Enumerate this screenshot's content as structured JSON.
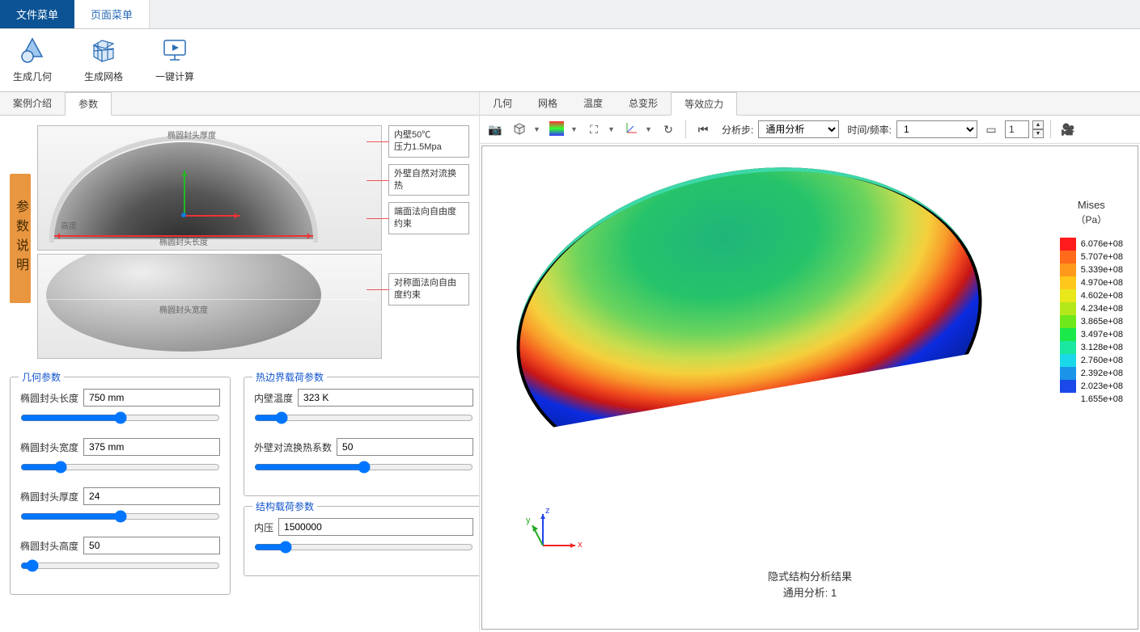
{
  "top_menu": {
    "file": "文件菜单",
    "page": "页面菜单"
  },
  "ribbon": {
    "gen_geom": "生成几何",
    "gen_mesh": "生成网格",
    "one_click": "一键计算"
  },
  "left_tabs": {
    "intro": "案例介绍",
    "params": "参数"
  },
  "diagram": {
    "vertical_label": "参数说明",
    "top_labels": {
      "thickness": "椭圆封头厚度",
      "height": "高度",
      "length": "椭圆封头长度"
    },
    "bottom_label": "椭圆封头宽度",
    "callouts": {
      "c1": "内壁50℃\n压力1.5Mpa",
      "c2": "外壁自然对流换热",
      "c3": "端面法向自由度约束",
      "c4": "对称面法向自由度约束"
    }
  },
  "param_groups": {
    "geom": {
      "legend": "几何参数",
      "length_label": "椭圆封头长度",
      "length_value": "750 mm",
      "width_label": "椭圆封头宽度",
      "width_value": "375 mm",
      "thick_label": "椭圆封头厚度",
      "thick_value": "24",
      "height_label": "椭圆封头高度",
      "height_value": "50"
    },
    "thermal": {
      "legend": "热边界载荷参数",
      "inner_temp_label": "内壁温度",
      "inner_temp_value": "323 K",
      "outer_conv_label": "外壁对流换热系数",
      "outer_conv_value": "50"
    },
    "struct": {
      "legend": "结构载荷参数",
      "pressure_label": "内压",
      "pressure_value": "1500000"
    }
  },
  "right_tabs": {
    "geom": "几何",
    "mesh": "网格",
    "temp": "温度",
    "total_deform": "总变形",
    "eq_stress": "等效应力"
  },
  "viz_toolbar": {
    "step_label": "分析步:",
    "step_value": "通用分析",
    "time_label": "时间/频率:",
    "time_value": "1",
    "spin_value": "1"
  },
  "result": {
    "legend_title": "Mises",
    "legend_unit": "（Pa）",
    "caption_line1": "隐式结构分析结果",
    "caption_line2": "通用分析: 1",
    "axes": {
      "x": "x",
      "y": "y",
      "z": "z"
    },
    "legend_values": [
      "6.076e+08",
      "5.707e+08",
      "5.339e+08",
      "4.970e+08",
      "4.602e+08",
      "4.234e+08",
      "3.865e+08",
      "3.497e+08",
      "3.128e+08",
      "2.760e+08",
      "2.392e+08",
      "2.023e+08",
      "1.655e+08"
    ],
    "legend_colors": [
      "#ff1b1b",
      "#ff6a1b",
      "#ff991b",
      "#ffc81b",
      "#e8e81b",
      "#b5e81b",
      "#6ee81b",
      "#1be84a",
      "#1be8a0",
      "#1bd8e8",
      "#1b94e8",
      "#1b48e8"
    ]
  }
}
